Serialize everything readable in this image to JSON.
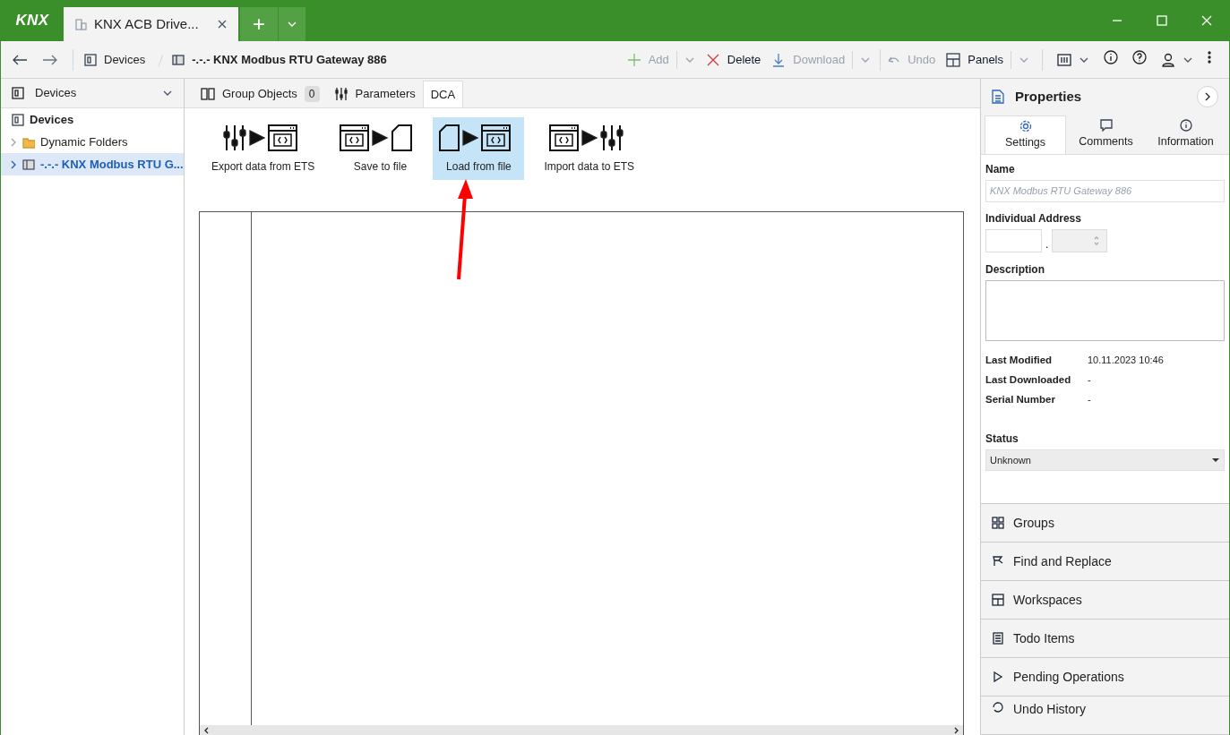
{
  "window": {
    "logo": "KNX",
    "tab_title": "KNX ACB Drive...",
    "new_tab": "+"
  },
  "toolbar": {
    "breadcrumb": [
      {
        "label": "Devices",
        "kind": "devices"
      },
      {
        "label": "-.-.- KNX Modbus RTU Gateway 886",
        "kind": "device"
      }
    ],
    "actions": [
      {
        "label": "Add",
        "kind": "add",
        "disabled": true,
        "dropdown": true
      },
      {
        "label": "Delete",
        "kind": "delete",
        "disabled": false,
        "dropdown": false
      },
      {
        "label": "Download",
        "kind": "download",
        "disabled": true,
        "dropdown": true
      },
      {
        "label": "Undo",
        "kind": "undo",
        "disabled": true,
        "dropdown": false
      },
      {
        "label": "Panels",
        "kind": "panels",
        "disabled": false,
        "dropdown": true
      }
    ]
  },
  "sidebar": {
    "header": "Devices",
    "items": [
      {
        "label": "Devices",
        "kind": "root",
        "selected": false,
        "expandable": false
      },
      {
        "label": "Dynamic Folders",
        "kind": "folder",
        "selected": false,
        "expandable": true
      },
      {
        "label": "-.-.- KNX Modbus RTU G...",
        "kind": "device",
        "selected": true,
        "expandable": true
      }
    ]
  },
  "tabs": [
    {
      "label": "Group Objects",
      "badge": "0",
      "kind": "objects",
      "selected": false
    },
    {
      "label": "Parameters",
      "kind": "params",
      "selected": false
    },
    {
      "label": "DCA",
      "kind": "plain",
      "selected": true
    }
  ],
  "dca_tools": [
    {
      "label": "Export data from ETS",
      "kind": "export",
      "selected": false
    },
    {
      "label": "Save to file",
      "kind": "save",
      "selected": false
    },
    {
      "label": "Load from file",
      "kind": "load",
      "selected": true
    },
    {
      "label": "Import data to ETS",
      "kind": "import",
      "selected": false
    }
  ],
  "properties": {
    "title": "Properties",
    "tabs": [
      {
        "label": "Settings",
        "kind": "settings",
        "selected": true
      },
      {
        "label": "Comments",
        "kind": "comments",
        "selected": false
      },
      {
        "label": "Information",
        "kind": "info",
        "selected": false
      }
    ],
    "name_label": "Name",
    "name_value": "KNX Modbus RTU Gateway 886",
    "address_label": "Individual Address",
    "address_separator": ".",
    "description_label": "Description",
    "info": [
      {
        "label": "Last Modified",
        "value": "10.11.2023 10:46"
      },
      {
        "label": "Last Downloaded",
        "value": "-"
      },
      {
        "label": "Serial Number",
        "value": "-"
      }
    ],
    "status_label": "Status",
    "status_value": "Unknown"
  },
  "panels": [
    {
      "label": "Groups",
      "kind": "groups"
    },
    {
      "label": "Find and Replace",
      "kind": "find"
    },
    {
      "label": "Workspaces",
      "kind": "workspaces"
    },
    {
      "label": "Todo Items",
      "kind": "todo"
    },
    {
      "label": "Pending Operations",
      "kind": "pending"
    },
    {
      "label": "Undo History",
      "kind": "history"
    }
  ]
}
